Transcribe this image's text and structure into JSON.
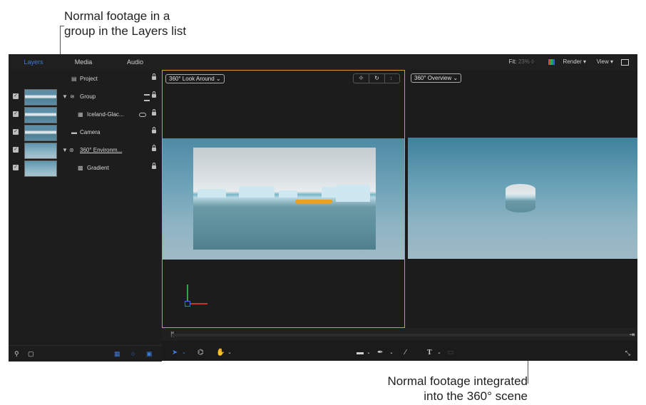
{
  "callouts": {
    "top_line1": "Normal footage in a",
    "top_line2": "group in the Layers list",
    "bottom_line1": "Normal footage integrated",
    "bottom_line2": "into the 360° scene"
  },
  "panel_tabs": [
    "Layers",
    "Media",
    "Audio"
  ],
  "toolbar_right": {
    "fit_label": "Fit:",
    "fit_value": "23% ◊",
    "render": "Render ▾",
    "view": "View ▾"
  },
  "layers": [
    {
      "name": "Project",
      "icon": "document-icon",
      "has_checkbox": false
    },
    {
      "name": "Group",
      "icon": "group-icon",
      "has_checkbox": true,
      "expanded": true
    },
    {
      "name": "Iceland-Glac...",
      "icon": "film-icon",
      "has_checkbox": true
    },
    {
      "name": "Camera",
      "icon": "camera-icon",
      "has_checkbox": true
    },
    {
      "name": "360° Environm...",
      "icon": "environment-icon",
      "has_checkbox": true,
      "expanded": true
    },
    {
      "name": "Gradient",
      "icon": "gradient-icon",
      "has_checkbox": true
    }
  ],
  "viewports": {
    "left_dropdown": "360° Look Around ⌄",
    "right_dropdown": "360° Overview ⌄"
  },
  "colors": {
    "accent": "#3e7bd8",
    "viewport_border": "#c9a227",
    "axis_x": "#d12e2e",
    "axis_y": "#2fa83a",
    "axis_z": "#3e6cff"
  }
}
